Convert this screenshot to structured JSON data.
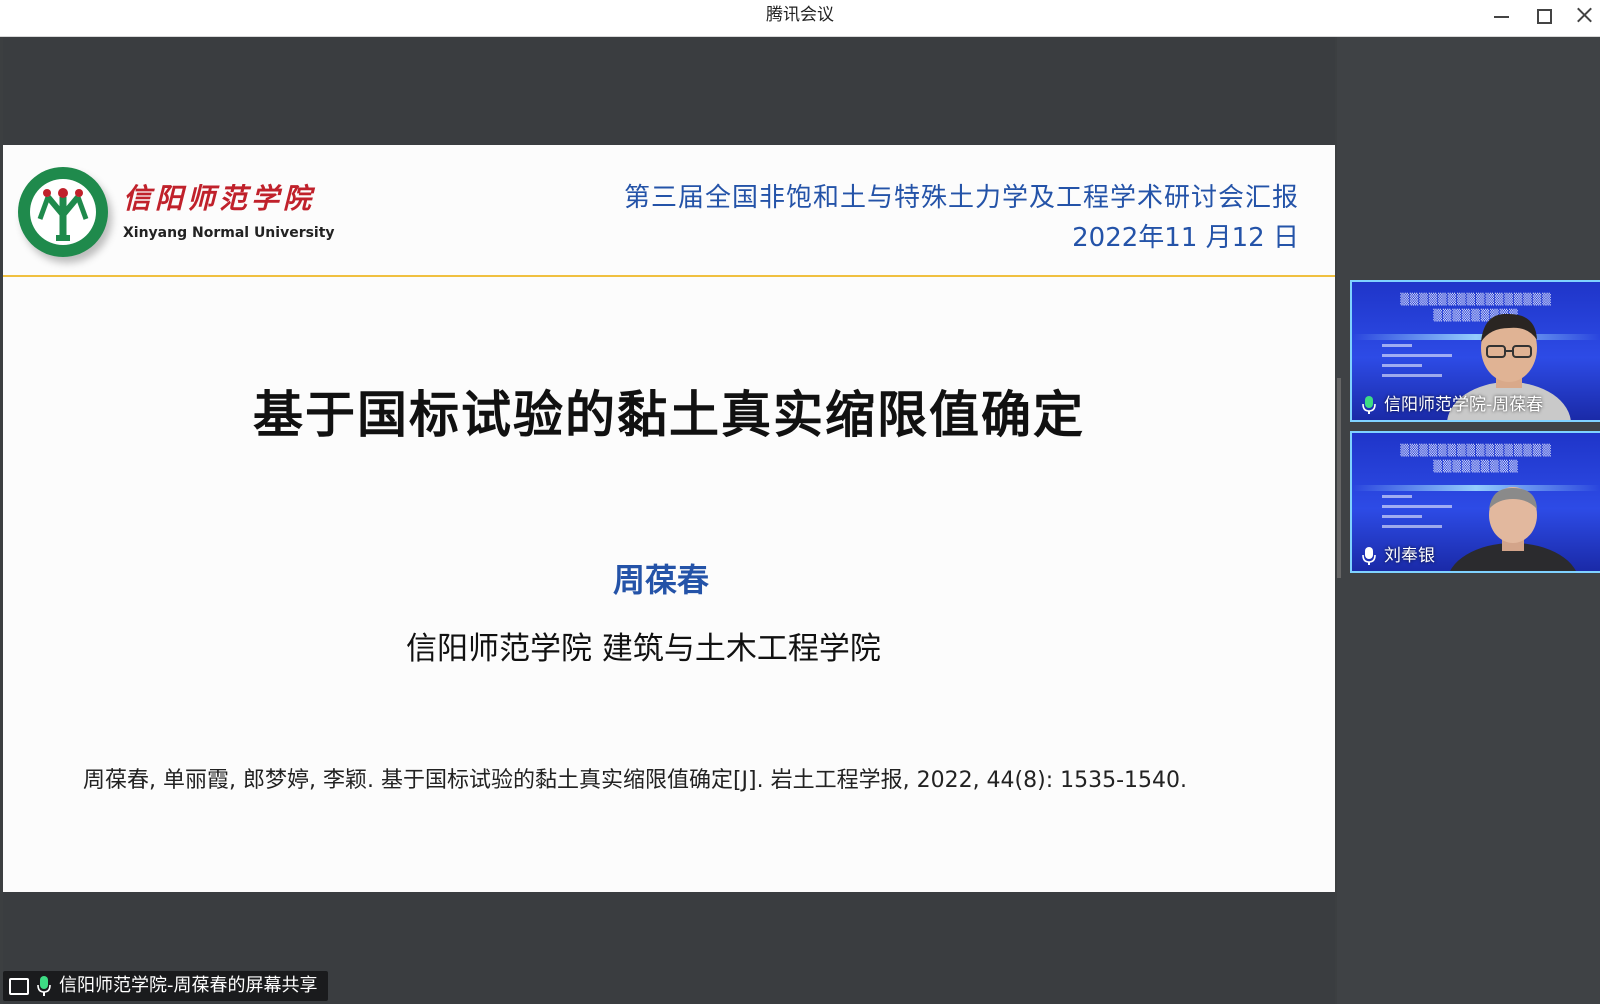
{
  "window": {
    "title": "腾讯会议"
  },
  "slide": {
    "logo_cn": "信阳师范学院",
    "logo_en": "Xinyang Normal University",
    "conference_title": "第三届全国非饱和土与特殊土力学及工程学术研讨会汇报",
    "conference_date": "2022年11 月12 日",
    "main_title": "基于国标试验的黏土真实缩限值确定",
    "author": "周葆春",
    "affiliation": "信阳师范学院  建筑与土木工程学院",
    "citation": "周葆春, 单丽霞, 郎梦婷, 李颖. 基于国标试验的黏土真实缩限值确定[J]. 岩土工程学报, 2022, 44(8): 1535-1540."
  },
  "share_status": {
    "label": "信阳师范学院-周葆春的屏幕共享"
  },
  "participants": [
    {
      "name": "信阳师范学院-周葆春",
      "mic_color": "#3ddc84"
    },
    {
      "name": "刘奉银",
      "mic_color": "#ffffff"
    }
  ],
  "colors": {
    "accent_blue": "#2453a8",
    "logo_red": "#c0212b",
    "logo_green": "#1f8a4c",
    "header_rule": "#f0c040",
    "tile_border": "#7fd2ff"
  }
}
